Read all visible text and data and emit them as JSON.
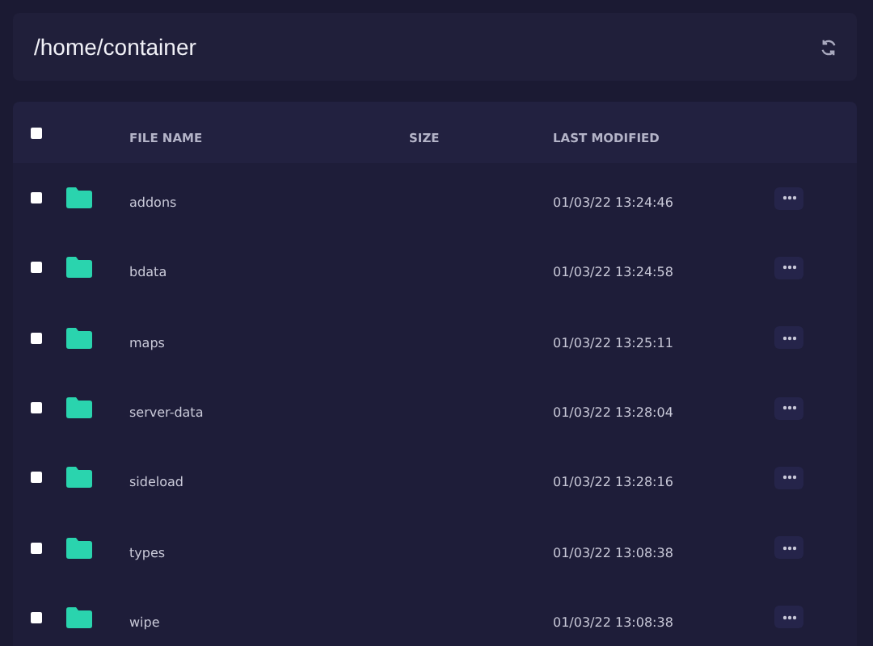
{
  "path": "/home/container",
  "table": {
    "columns": [
      "FILE NAME",
      "SIZE",
      "LAST MODIFIED"
    ],
    "select_all": {
      "checked": false
    },
    "rows": [
      {
        "name": "addons",
        "kind": "folder",
        "modified": "01/03/22 13:24:46",
        "checked": false
      },
      {
        "name": "bdata",
        "kind": "folder",
        "modified": "01/03/22 13:24:58",
        "checked": false
      },
      {
        "name": "maps",
        "kind": "folder",
        "modified": "01/03/22 13:25:11",
        "checked": false
      },
      {
        "name": "server-data",
        "kind": "folder",
        "modified": "01/03/22 13:28:04",
        "checked": false
      },
      {
        "name": "sideload",
        "kind": "folder",
        "modified": "01/03/22 13:28:16",
        "checked": false
      },
      {
        "name": "types",
        "kind": "folder",
        "modified": "01/03/22 13:08:38",
        "checked": false
      },
      {
        "name": "wipe",
        "kind": "folder",
        "modified": "01/03/22 13:08:38",
        "checked": false
      }
    ]
  }
}
